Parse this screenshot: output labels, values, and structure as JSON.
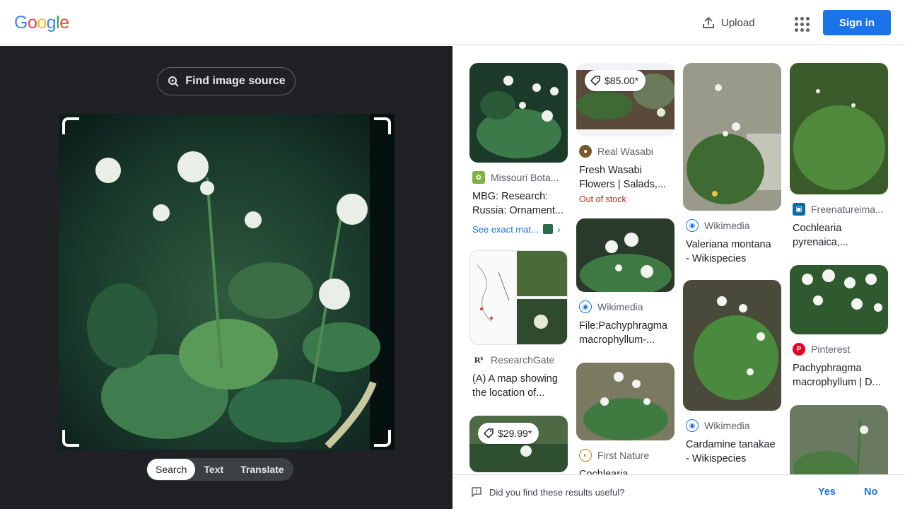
{
  "header": {
    "logo_letters": [
      "G",
      "o",
      "o",
      "g",
      "l",
      "e"
    ],
    "upload_label": "Upload",
    "signin_label": "Sign in"
  },
  "lens": {
    "find_source_label": "Find image source",
    "modes": [
      {
        "label": "Search",
        "active": true
      },
      {
        "label": "Text",
        "active": false
      },
      {
        "label": "Translate",
        "active": false
      }
    ]
  },
  "results": {
    "col1": [
      {
        "source": "Missouri Bota...",
        "icon": "plant-logo-icon",
        "title_line1": "MBG: Research:",
        "title_line2": "Russia: Ornament...",
        "exact_label": "See exact mat..."
      },
      {
        "source": "ResearchGate",
        "icon": "researchgate-logo-icon",
        "title_line1": "(A) A map showing",
        "title_line2": "the location of..."
      },
      {
        "price": "$29.99*"
      }
    ],
    "col2": [
      {
        "price": "$85.00*",
        "source": "Real Wasabi",
        "icon": "wasabi-logo-icon",
        "title_line1": "Fresh Wasabi",
        "title_line2": "Flowers | Salads,...",
        "stock": "Out of stock"
      },
      {
        "source": "Wikimedia",
        "icon": "wikimedia-logo-icon",
        "title_line1": "File:Pachyphragma",
        "title_line2": "macrophyllum-..."
      },
      {
        "source": "First Nature",
        "icon": "firstnature-logo-icon",
        "title_line1": "Cochlearia",
        "title_line2": ""
      }
    ],
    "col3": [
      {
        "source": "Wikimedia",
        "icon": "wikimedia-logo-icon",
        "title_line1": "Valeriana montana",
        "title_line2": "- Wikispecies"
      },
      {
        "source": "Wikimedia",
        "icon": "wikimedia-logo-icon",
        "title_line1": "Cardamine tanakae",
        "title_line2": "- Wikispecies"
      }
    ],
    "col4": [
      {
        "source": "Freenatureima...",
        "icon": "freenature-logo-icon",
        "title_line1": "Cochlearia",
        "title_line2": "pyrenaica,..."
      },
      {
        "source": "Pinterest",
        "icon": "pinterest-logo-icon",
        "title_line1": "Pachyphragma",
        "title_line2": "macrophyllum | D..."
      }
    ]
  },
  "feedback": {
    "question": "Did you find these results useful?",
    "yes": "Yes",
    "no": "No"
  }
}
